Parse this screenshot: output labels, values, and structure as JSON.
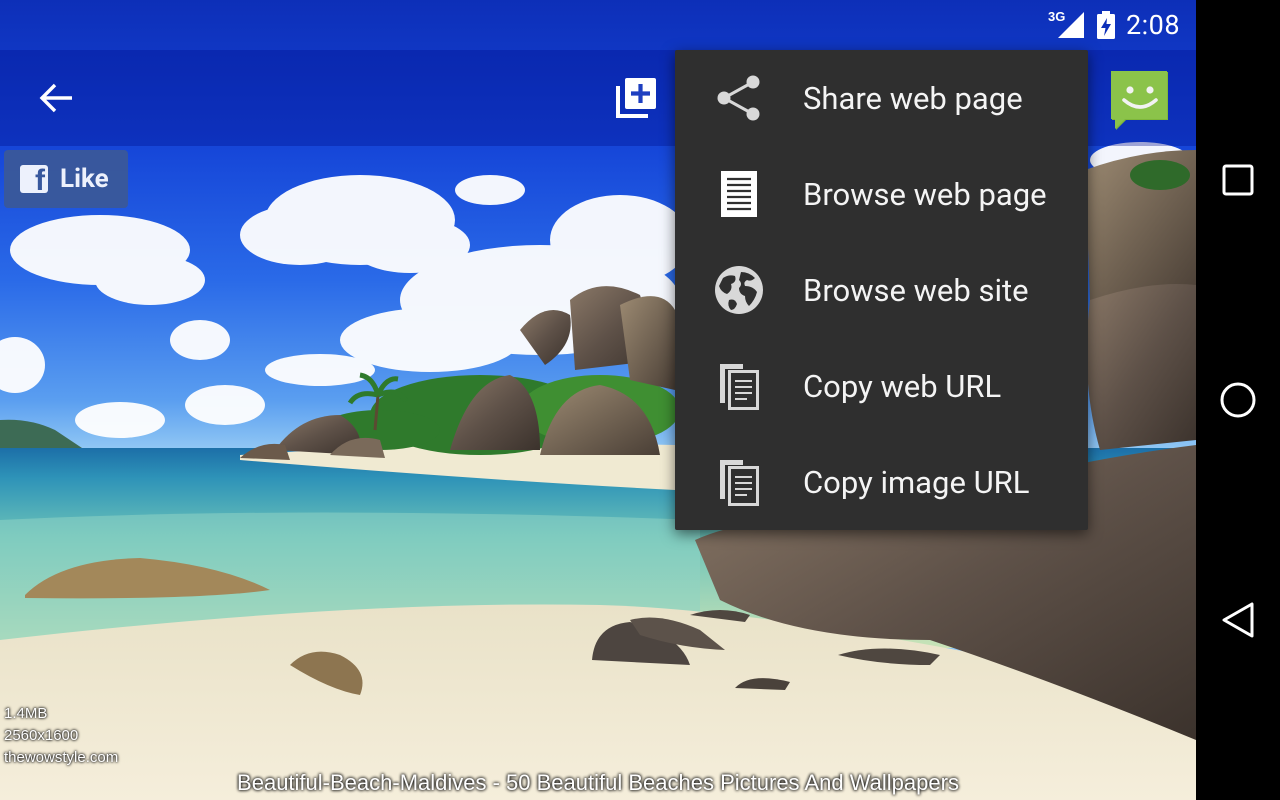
{
  "status_bar": {
    "network": "3G",
    "clock": "2:08",
    "icons": [
      "signal-icon",
      "battery-charging-icon"
    ]
  },
  "action_bar": {
    "icons": [
      "back-arrow-icon",
      "add-to-library-icon",
      "app-avatar-icon"
    ],
    "avatar_color": "#8bc34a"
  },
  "facebook": {
    "like_label": "Like",
    "icon": "facebook-f-icon",
    "color": "#3b5998"
  },
  "menu": {
    "items": [
      {
        "label": "Share web page",
        "icon": "share-icon"
      },
      {
        "label": "Browse web page",
        "icon": "document-icon"
      },
      {
        "label": "Browse web site",
        "icon": "globe-icon"
      },
      {
        "label": "Copy web URL",
        "icon": "copy-icon"
      },
      {
        "label": "Copy image URL",
        "icon": "copy-icon"
      }
    ],
    "background": "#2f2f2f"
  },
  "image_info": {
    "size": "1.4MB",
    "dimensions": "2560x1600",
    "source": "thewowstyle.com"
  },
  "caption": "Beautiful-Beach-Maldives - 50 Beautiful Beaches Pictures And Wallpapers",
  "nav_bar": {
    "icons": [
      "recent-apps-icon",
      "home-icon",
      "back-triangle-icon"
    ]
  }
}
